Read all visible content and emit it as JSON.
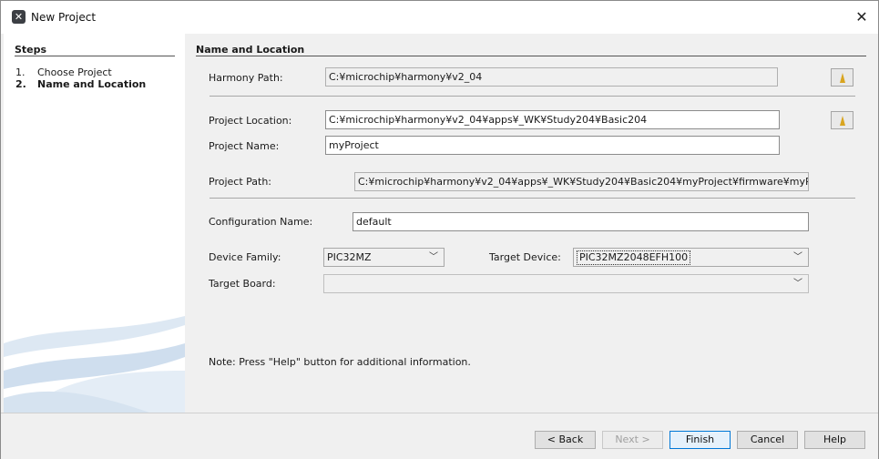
{
  "window": {
    "title": "New Project",
    "close_glyph": "✕"
  },
  "steps": {
    "heading": "Steps",
    "items": [
      {
        "num": "1.",
        "label": "Choose Project"
      },
      {
        "num": "2.",
        "label": "Name and Location"
      }
    ]
  },
  "panel": {
    "heading": "Name and Location",
    "harmony_path": {
      "label": "Harmony Path:",
      "value": "C:¥microchip¥harmony¥v2_04"
    },
    "project_location": {
      "label": "Project Location:",
      "value": "C:¥microchip¥harmony¥v2_04¥apps¥_WK¥Study204¥Basic204"
    },
    "project_name": {
      "label": "Project Name:",
      "value": "myProject"
    },
    "project_path": {
      "label": "Project Path:",
      "value": "C:¥microchip¥harmony¥v2_04¥apps¥_WK¥Study204¥Basic204¥myProject¥firmware¥myProject.X"
    },
    "configuration_name": {
      "label": "Configuration Name:",
      "value": "default"
    },
    "device_family": {
      "label": "Device Family:",
      "value": "PIC32MZ"
    },
    "target_device": {
      "label": "Target Device:",
      "value": "PIC32MZ2048EFH100"
    },
    "target_board": {
      "label": "Target Board:",
      "value": ""
    },
    "note": "Note:  Press \"Help\" button for additional information."
  },
  "buttons": {
    "back": "< Back",
    "next": "Next >",
    "finish": "Finish",
    "cancel": "Cancel",
    "help": "Help"
  },
  "icons": {
    "app": "app-icon",
    "browse": "folder-icon",
    "dropdown": "chevron-down-icon"
  }
}
